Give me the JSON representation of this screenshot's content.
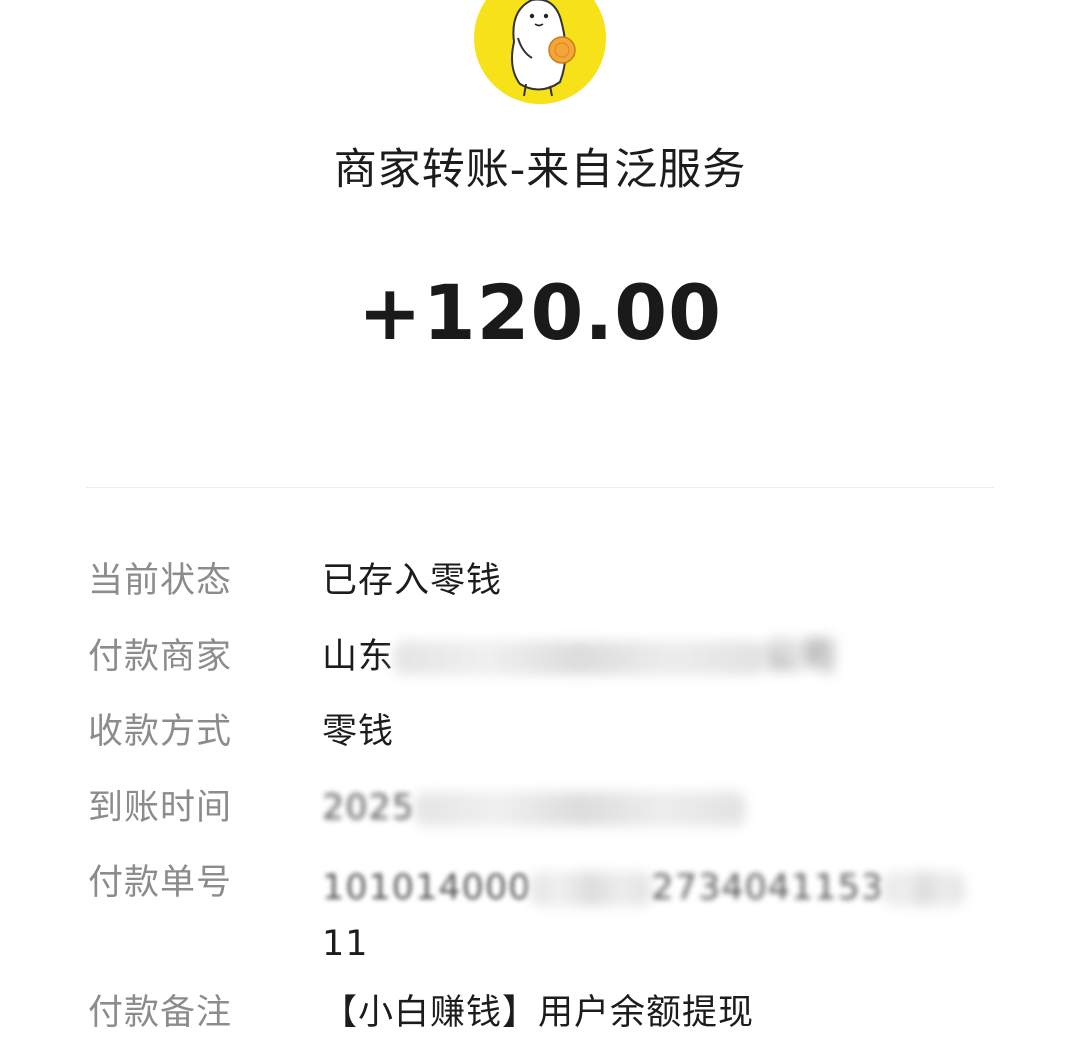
{
  "header": {
    "title": "商家转账-来自泛服务",
    "amount": "+120.00"
  },
  "details": [
    {
      "label": "当前状态",
      "value": "已存入零钱"
    },
    {
      "label": "付款商家",
      "value_visible": "山东",
      "value_tail": "公司"
    },
    {
      "label": "收款方式",
      "value": "零钱"
    },
    {
      "label": "到账时间",
      "value_visible": "2025"
    },
    {
      "label": "付款单号",
      "value_visible": "101014000",
      "value_mid": "2734041153",
      "value_wrap": "11"
    },
    {
      "label": "付款备注",
      "value_visible": "【小白赚钱】用户余额提现"
    }
  ],
  "colors": {
    "avatar_bg": "#f7e21a",
    "label_text": "#8c8c8c",
    "value_text": "#1c1c1c",
    "divider": "#ececec"
  },
  "icons": {
    "avatar": "cartoon-character-avatar"
  }
}
